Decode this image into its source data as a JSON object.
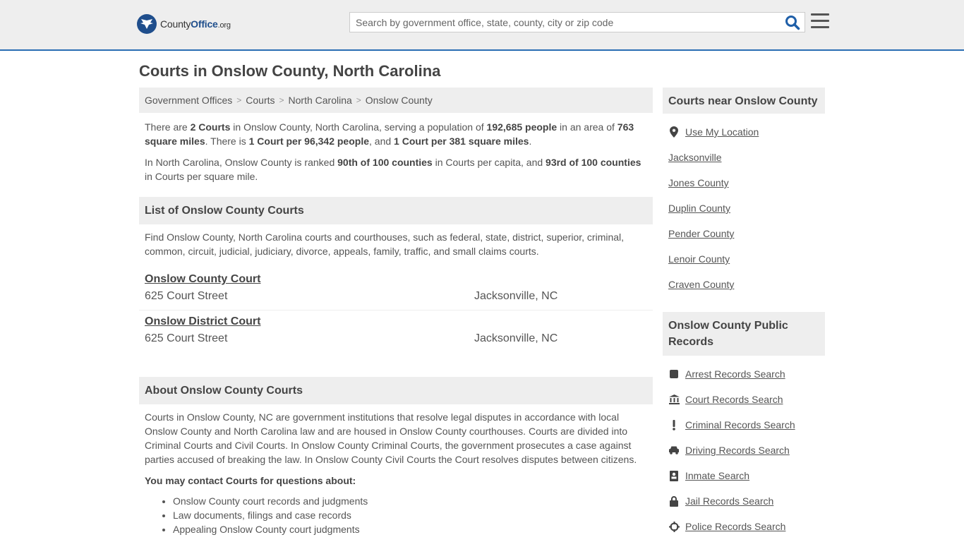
{
  "header": {
    "logo_prefix": "County",
    "logo_brand": "Office",
    "logo_tld": ".org",
    "search_placeholder": "Search by government office, state, county, city or zip code"
  },
  "page_title": "Courts in Onslow County, North Carolina",
  "breadcrumb": [
    "Government Offices",
    "Courts",
    "North Carolina",
    "Onslow County"
  ],
  "intro": {
    "p1": {
      "t1": "There are ",
      "b1": "2 Courts",
      "t2": " in Onslow County, North Carolina, serving a population of ",
      "b2": "192,685 people",
      "t3": " in an area of ",
      "b3": "763 square miles",
      "t4": ". There is ",
      "b4": "1 Court per 96,342 people",
      "t5": ", and ",
      "b5": "1 Court per 381 square miles",
      "t6": "."
    },
    "p2": {
      "t1": "In North Carolina, Onslow County is ranked ",
      "b1": "90th of 100 counties",
      "t2": " in Courts per capita, and ",
      "b2": "93rd of 100 counties",
      "t3": " in Courts per square mile."
    }
  },
  "list_section": {
    "heading": "List of Onslow County Courts",
    "description": "Find Onslow County, North Carolina courts and courthouses, such as federal, state, district, superior, criminal, common, circuit, judicial, judiciary, divorce, appeals, family, traffic, and small claims courts.",
    "courts": [
      {
        "name": "Onslow County Court",
        "address": "625 Court Street",
        "city": "Jacksonville, NC"
      },
      {
        "name": "Onslow District Court",
        "address": "625 Court Street",
        "city": "Jacksonville, NC"
      }
    ]
  },
  "about_section": {
    "heading": "About Onslow County Courts",
    "body": "Courts in Onslow County, NC are government institutions that resolve legal disputes in accordance with local Onslow County and North Carolina law and are housed in Onslow County courthouses. Courts are divided into Criminal Courts and Civil Courts. In Onslow County Criminal Courts, the government prosecutes a case against parties accused of breaking the law. In Onslow County Civil Courts the Court resolves disputes between citizens.",
    "contact_heading": "You may contact Courts for questions about:",
    "bullets": [
      "Onslow County court records and judgments",
      "Law documents, filings and case records",
      "Appealing Onslow County court judgments"
    ]
  },
  "sidebar": {
    "near_heading": "Courts near Onslow County",
    "use_location": "Use My Location",
    "near_links": [
      "Jacksonville",
      "Jones County",
      "Duplin County",
      "Pender County",
      "Lenoir County",
      "Craven County"
    ],
    "records_heading": "Onslow County Public Records",
    "records_links": [
      {
        "label": "Arrest Records Search",
        "icon": "arrest-icon"
      },
      {
        "label": "Court Records Search",
        "icon": "courthouse-icon"
      },
      {
        "label": "Criminal Records Search",
        "icon": "exclamation-icon"
      },
      {
        "label": "Driving Records Search",
        "icon": "car-icon"
      },
      {
        "label": "Inmate Search",
        "icon": "inmate-icon"
      },
      {
        "label": "Jail Records Search",
        "icon": "lock-icon"
      },
      {
        "label": "Police Records Search",
        "icon": "crosshair-icon"
      }
    ]
  }
}
